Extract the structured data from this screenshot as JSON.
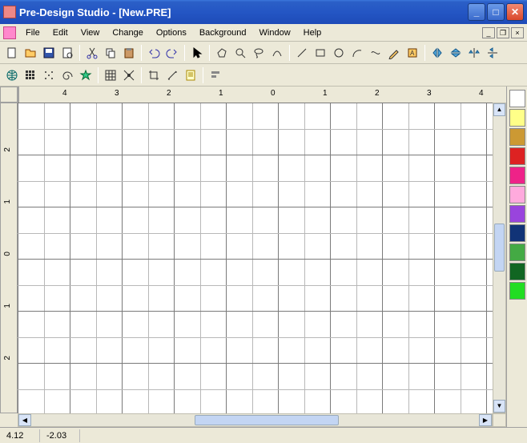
{
  "title": "Pre-Design Studio - [New.PRE]",
  "menus": [
    "File",
    "Edit",
    "View",
    "Change",
    "Options",
    "Background",
    "Window",
    "Help"
  ],
  "ruler_h": [
    {
      "pos": 55,
      "label": "4"
    },
    {
      "pos": 120,
      "label": "3"
    },
    {
      "pos": 185,
      "label": "2"
    },
    {
      "pos": 250,
      "label": "1"
    },
    {
      "pos": 315,
      "label": "0"
    },
    {
      "pos": 380,
      "label": "1"
    },
    {
      "pos": 445,
      "label": "2"
    },
    {
      "pos": 510,
      "label": "3"
    },
    {
      "pos": 575,
      "label": "4"
    }
  ],
  "ruler_v": [
    {
      "pos": 55,
      "label": "2"
    },
    {
      "pos": 120,
      "label": "1"
    },
    {
      "pos": 185,
      "label": "0"
    },
    {
      "pos": 250,
      "label": "1"
    },
    {
      "pos": 315,
      "label": "2"
    }
  ],
  "palette": [
    "#ffffff",
    "#ffff88",
    "#cc9933",
    "#dd2222",
    "#ee2288",
    "#ffaadd",
    "#9944dd",
    "#113377",
    "#44aa44",
    "#116622",
    "#22dd22"
  ],
  "status": {
    "x": "4.12",
    "y": "-2.03"
  }
}
